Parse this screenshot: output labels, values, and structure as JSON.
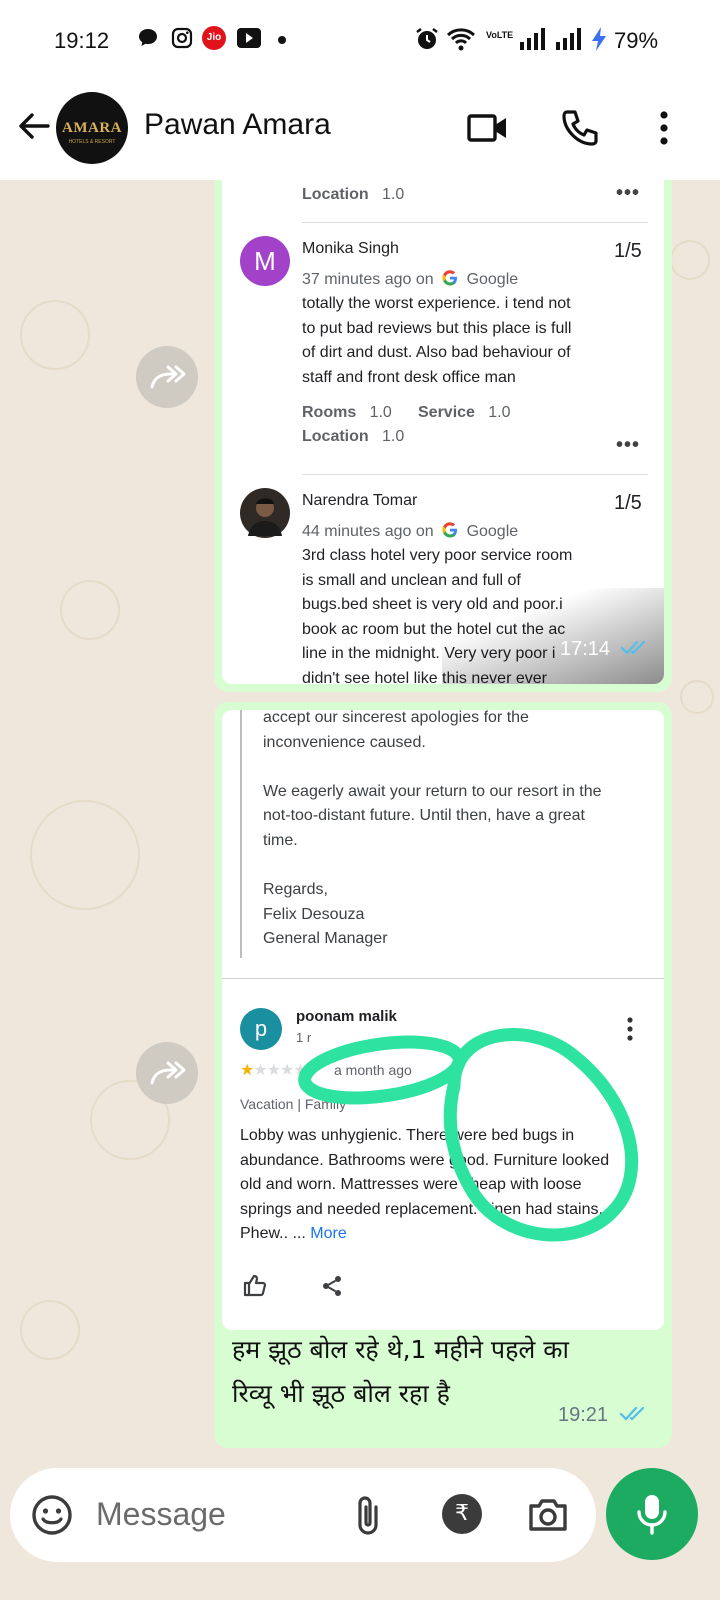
{
  "status_bar": {
    "time": "19:12",
    "battery": "79%",
    "icons": [
      "chat-bubble-icon",
      "instagram-icon",
      "jio-icon",
      "youtube-icon",
      "dot-icon",
      "alarm-icon",
      "wifi-icon",
      "volte-icon",
      "signal-icon",
      "signal-icon",
      "charging-icon"
    ],
    "jio_label": "Jio",
    "volte_label": "VoLTE"
  },
  "header": {
    "contact_name": "Pawan Amara",
    "avatar_logo_text": "AMARA",
    "avatar_logo_sub": "HOTELS & RESORT",
    "icons": [
      "back-arrow-icon",
      "video-call-icon",
      "phone-icon",
      "more-vert-icon"
    ]
  },
  "message1": {
    "top_row": {
      "attr_label": "Location",
      "attr_value": "1.0"
    },
    "reviews": [
      {
        "avatar_letter": "M",
        "avatar_color": "#a142c9",
        "name": "Monika Singh",
        "score": "1/5",
        "time": "37 minutes ago on",
        "source": "Google",
        "text": [
          "totally the worst experience. i tend not",
          "to put bad reviews but this place is full",
          "of dirt and dust. Also bad behaviour of",
          "staff and front desk office man"
        ],
        "rooms_label": "Rooms",
        "rooms_value": "1.0",
        "service_label": "Service",
        "service_value": "1.0",
        "location_label": "Location",
        "location_value": "1.0"
      },
      {
        "name": "Narendra Tomar",
        "score": "1/5",
        "time": "44 minutes ago on",
        "source": "Google",
        "text": [
          "3rd class hotel very poor service room",
          "is small and unclean and full of",
          "bugs.bed sheet is very old and poor.i",
          "book ac room but the hotel cut the ac",
          "line in the midnight. Very very poor i",
          "didn't see hotel like this never ever"
        ]
      }
    ],
    "timestamp": "17:14"
  },
  "message2": {
    "reply_lines": [
      "accept our sincerest apologies for the",
      "inconvenience caused.",
      "",
      "We eagerly await your return to our resort in the",
      "not-too-distant future. Until then, have a great",
      "time.",
      "",
      "Regards,",
      "Felix Desouza",
      "General Manager"
    ],
    "review": {
      "avatar_letter": "p",
      "avatar_color": "#1a8fa0",
      "name": "poonam malik",
      "sub": "1 r",
      "rating": 1,
      "rating_max": 5,
      "time": "a month ago",
      "trip": "Vacation",
      "trip_type": "Family",
      "text": [
        "Lobby was unhygienic. There were bed bugs in",
        "abundance. Bathrooms were good. Furniture looked",
        "old and worn. Mattresses were cheap with loose",
        "springs and needed replacement. Linen had stains.",
        "Phew.. ..."
      ],
      "more_label": "More",
      "highlight_color": "#2ee3a0"
    },
    "caption": [
      "हम झूठ बोल रहे थे,1 महीने पहले का",
      "रिव्यू भी झूठ  बोल रहा है"
    ],
    "timestamp": "19:21",
    "tick_color": "#53bdeb"
  },
  "input_bar": {
    "placeholder": "Message",
    "icons": [
      "emoji-icon",
      "attach-icon",
      "rupee-icon",
      "camera-icon",
      "mic-icon"
    ]
  }
}
